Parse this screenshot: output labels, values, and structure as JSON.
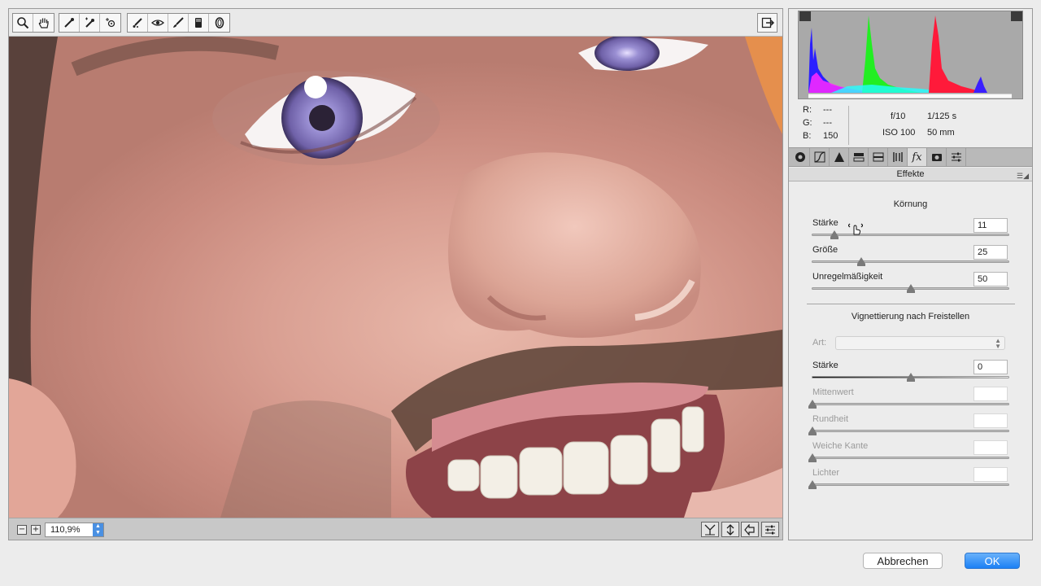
{
  "toolbar": {
    "tools": [
      "zoom-icon",
      "hand-icon",
      "white-balance-icon",
      "color-sampler-icon",
      "target-adjust-icon",
      "spot-removal-icon",
      "red-eye-icon",
      "adjustment-brush-icon",
      "graduated-filter-icon",
      "radial-filter-icon"
    ]
  },
  "status": {
    "zoom_value": "110,9%",
    "zoom_out_label": "−",
    "zoom_in_label": "+"
  },
  "info": {
    "r_label": "R:",
    "r_value": "---",
    "g_label": "G:",
    "g_value": "---",
    "b_label": "B:",
    "b_value": "150",
    "aperture": "f/10",
    "shutter": "1/125 s",
    "iso": "ISO 100",
    "focal": "50 mm"
  },
  "panel": {
    "title": "Effekte",
    "grain": {
      "title": "Körnung",
      "sliders": [
        {
          "label": "Stärke",
          "value": "11",
          "position": 0.11
        },
        {
          "label": "Größe",
          "value": "25",
          "position": 0.25
        },
        {
          "label": "Unregelmäßigkeit",
          "value": "50",
          "position": 0.5
        }
      ]
    },
    "vignette": {
      "title": "Vignettierung nach Freistellen",
      "art_label": "Art:",
      "art_value": "",
      "amount": {
        "label": "Stärke",
        "value": "0",
        "position": 0.5
      },
      "disabled_sliders": [
        {
          "label": "Mittenwert",
          "value": "",
          "position": 0
        },
        {
          "label": "Rundheit",
          "value": "",
          "position": 0
        },
        {
          "label": "Weiche Kante",
          "value": "",
          "position": 0
        },
        {
          "label": "Lichter",
          "value": "",
          "position": 0
        }
      ]
    }
  },
  "buttons": {
    "cancel": "Abbrechen",
    "ok": "OK"
  },
  "colors": {
    "accent": "#1b80f5",
    "histogram_bg": "#a9a9a9"
  }
}
